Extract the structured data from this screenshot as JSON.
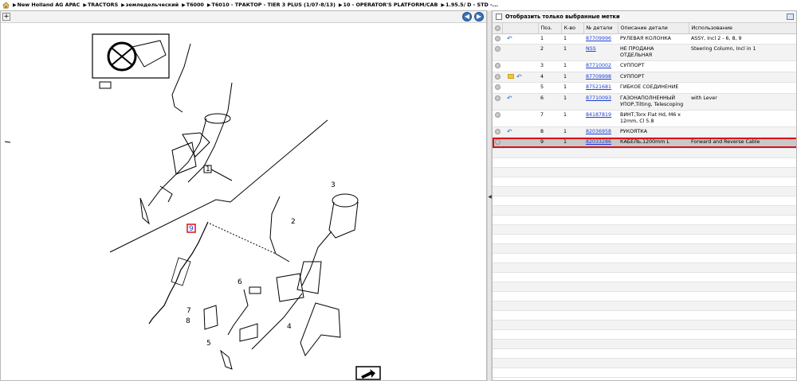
{
  "breadcrumb": [
    "New Holland AG APAC",
    "TRACTORS",
    "земледельческий",
    "T6000",
    "T6010 - ТРАКТОР - TIER 3 PLUS (1/07-8/13)",
    "10 - OPERATOR'S PLATFORM/CAB",
    "1.95.5/  D - STD -..."
  ],
  "right_panel": {
    "filter_label": "Отобразить только выбранные метки",
    "columns": [
      "Поз.",
      "К-во",
      "№ детали",
      "Описание детали",
      "Использование"
    ],
    "rows": [
      {
        "pos": "1",
        "qty": "1",
        "part": "87709996",
        "desc": "РУЛЕВАЯ КОЛОНКА",
        "usage": "ASSY, Incl 2 - 6, 8, 9",
        "icons": "undo"
      },
      {
        "pos": "2",
        "qty": "1",
        "part": "NSS",
        "desc": "НЕ ПРОДАНА ОТДЕЛЬНАЯ",
        "usage": "Steering Column, Incl in 1",
        "icons": ""
      },
      {
        "pos": "3",
        "qty": "1",
        "part": "87710002",
        "desc": "СУППОРТ",
        "usage": "",
        "icons": ""
      },
      {
        "pos": "4",
        "qty": "1",
        "part": "87709998",
        "desc": "СУППОРТ",
        "usage": "",
        "icons": "folder-undo"
      },
      {
        "pos": "5",
        "qty": "1",
        "part": "87521681",
        "desc": "ГИБКОЕ СОЕДИНЕНИЕ",
        "usage": "",
        "icons": ""
      },
      {
        "pos": "6",
        "qty": "1",
        "part": "87710093",
        "desc": "ГАЗОНАПОЛНЕННЫЙ УПОР,Tilting, Telescoping",
        "usage": "with Lever",
        "icons": "undo"
      },
      {
        "pos": "7",
        "qty": "1",
        "part": "84187819",
        "desc": "ВИНТ,Torx Flat Hd, M6 x 12mm, Cl 5.8",
        "usage": "",
        "icons": ""
      },
      {
        "pos": "8",
        "qty": "1",
        "part": "82036958",
        "desc": "РУКОЯТКА",
        "usage": "",
        "icons": "undo"
      },
      {
        "pos": "9",
        "qty": "1",
        "part": "82033286",
        "desc": "КАБЕЛЬ,1200mm L",
        "usage": "Forward and Reverse Cable",
        "icons": "",
        "selected": true
      }
    ]
  },
  "drawing": {
    "callouts": [
      "1",
      "2",
      "3",
      "4",
      "5",
      "6",
      "7",
      "8",
      "9"
    ]
  }
}
